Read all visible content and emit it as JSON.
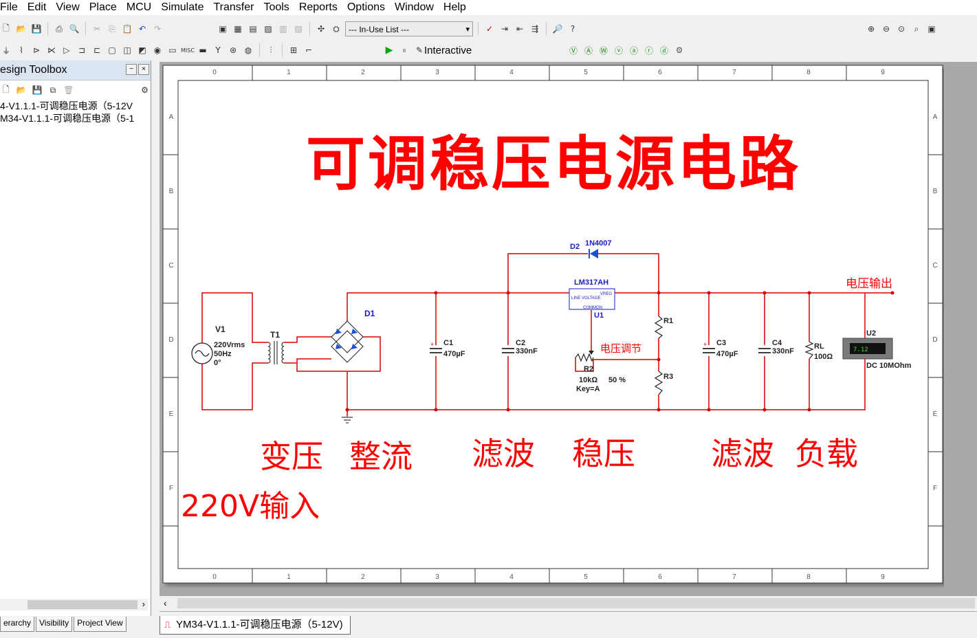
{
  "menu": [
    "File",
    "Edit",
    "View",
    "Place",
    "MCU",
    "Simulate",
    "Transfer",
    "Tools",
    "Reports",
    "Options",
    "Window",
    "Help"
  ],
  "toolbar": {
    "inuse_list": "--- In-Use List ---",
    "interactive": "Interactive"
  },
  "panel": {
    "title": "esign Toolbox",
    "items": [
      "4-V1.1.1-可调稳压电源（5-12V",
      "M34-V1.1.1-可调稳压电源（5-1"
    ]
  },
  "left_tabs": [
    "erarchy",
    "Visibility",
    "Project View"
  ],
  "doc_tab": "YM34-V1.1.1-可调稳压电源（5-12V)",
  "sheet": {
    "cols": [
      "0",
      "1",
      "2",
      "3",
      "4",
      "5",
      "6",
      "7",
      "8",
      "9"
    ],
    "rows": [
      "A",
      "B",
      "C",
      "D",
      "E",
      "F"
    ],
    "title": "可调稳压电源电路",
    "sections": [
      "变压",
      "整流",
      "滤波",
      "稳压",
      "滤波",
      "负载"
    ],
    "input_label": "220V输入",
    "output_label": "电压输出",
    "adjust_label": "电压调节"
  },
  "components": {
    "v1": {
      "ref": "V1",
      "line1": "220Vrms",
      "line2": "50Hz",
      "line3": "0°"
    },
    "t1": "T1",
    "d1": "D1",
    "c1": {
      "ref": "C1",
      "value": "470µF"
    },
    "c2": {
      "ref": "C2",
      "value": "330nF"
    },
    "d2": {
      "ref": "D2",
      "value": "1N4007"
    },
    "u1": {
      "ref": "U1",
      "part": "LM317AH",
      "pin_in": "LINE VOLTAGE",
      "pin_out": "VREG",
      "pin_adj": "COMMON"
    },
    "r1": "R1",
    "r2": {
      "ref": "R2",
      "value": "10kΩ",
      "pct": "50 %",
      "key": "Key=A"
    },
    "r3": "R3",
    "c3": {
      "ref": "C3",
      "value": "470µF"
    },
    "c4": {
      "ref": "C4",
      "value": "330nF"
    },
    "rl": {
      "ref": "RL",
      "value": "100Ω"
    },
    "u2": {
      "ref": "U2",
      "reading": "7.12",
      "mode": "DC  10MOhm"
    }
  },
  "colors": {
    "wire": "#d40000",
    "part": "#0000cc",
    "label": "#ff0000",
    "panel_title": "#dbe4f1"
  }
}
